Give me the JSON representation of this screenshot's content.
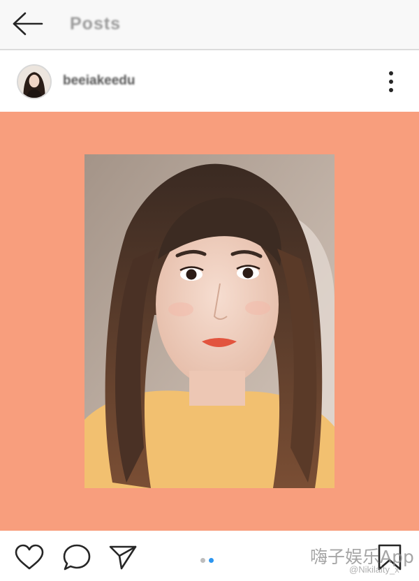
{
  "app": {
    "title": "Posts",
    "back_icon": "arrow-left-icon"
  },
  "post": {
    "username": "beeiakeedu",
    "more_icon": "more-vertical-icon",
    "media_background": "#f89e7d",
    "photo_subject": "selfie-portrait",
    "carousel": {
      "count": 2,
      "active_index": 1
    }
  },
  "actions": {
    "like_icon": "heart-icon",
    "comment_icon": "comment-bubble-icon",
    "share_icon": "send-icon",
    "save_icon": "bookmark-icon"
  },
  "watermark": {
    "logo": "嗨子娱乐App",
    "handle": "@Nikilaity_x"
  },
  "colors": {
    "accent_dot": "#2d96f0",
    "inactive_dot": "#bdbdbd",
    "topbar": "#f8f8f8"
  }
}
